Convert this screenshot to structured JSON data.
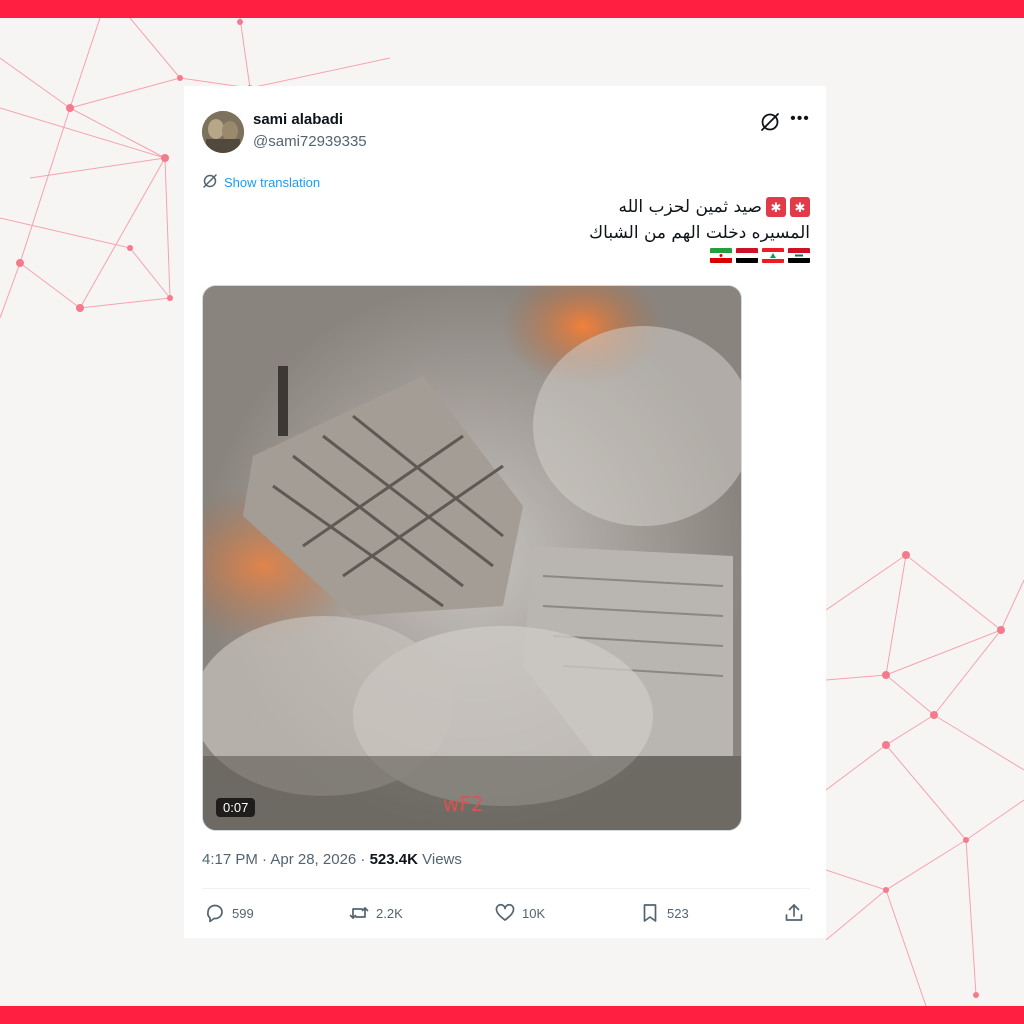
{
  "colors": {
    "frame_accent": "#ff1f40",
    "background": "#f7f5f4",
    "link": "#1d9bf0",
    "text_primary": "#0f1419",
    "text_secondary": "#536471"
  },
  "tweet": {
    "author": {
      "display_name": "sami alabadi",
      "handle": "@sami72939335"
    },
    "show_translation_label": "Show translation",
    "text_line1": "صيد ثمين لحزب الله",
    "text_line2": "المسيره دخلت الهم من الشباك",
    "flags": [
      "iran-flag",
      "yemen-flag",
      "lebanon-flag",
      "iraq-flag"
    ],
    "emojis": [
      "police-light-icon",
      "police-light-icon"
    ],
    "video": {
      "duration": "0:07",
      "description_icon": "video-thumbnail"
    },
    "timestamp": "4:17 PM · Apr 28, 2026 · ",
    "views_count": "523.4K",
    "views_label": " Views",
    "actions": {
      "replies": "599",
      "reposts": "2.2K",
      "likes": "10K",
      "bookmarks": "523"
    }
  }
}
